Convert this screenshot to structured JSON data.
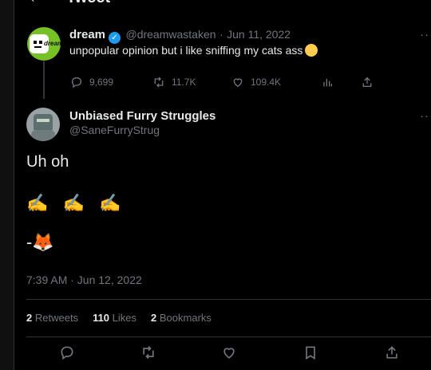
{
  "header": {
    "back_icon": "arrow-left-icon",
    "title": "Tweet"
  },
  "quoted_tweet": {
    "name": "dream",
    "handle": "@dreamwastaken",
    "date": "Jun 11, 2022",
    "text": "unpopular opinion but i like sniffing my cats ass",
    "avatar_word": "dream",
    "actions": {
      "replies": "9,699",
      "retweets": "11.7K",
      "likes": "109.4K"
    }
  },
  "main_tweet": {
    "name": "Unbiased Furry Struggles",
    "handle": "@SaneFurryStrug",
    "text": "Uh oh",
    "emoji_line": "✍️ ✍️ ✍️",
    "signature": "-🦊",
    "timestamp": "7:39 AM · Jun 12, 2022",
    "stats": {
      "retweets_count": "2",
      "retweets_label": "Retweets",
      "likes_count": "110",
      "likes_label": "Likes",
      "bookmarks_count": "2",
      "bookmarks_label": "Bookmarks"
    }
  },
  "colors": {
    "background": "#000000",
    "accent": "#1d9bf0",
    "muted": "#71767b",
    "border": "#2f3336"
  }
}
